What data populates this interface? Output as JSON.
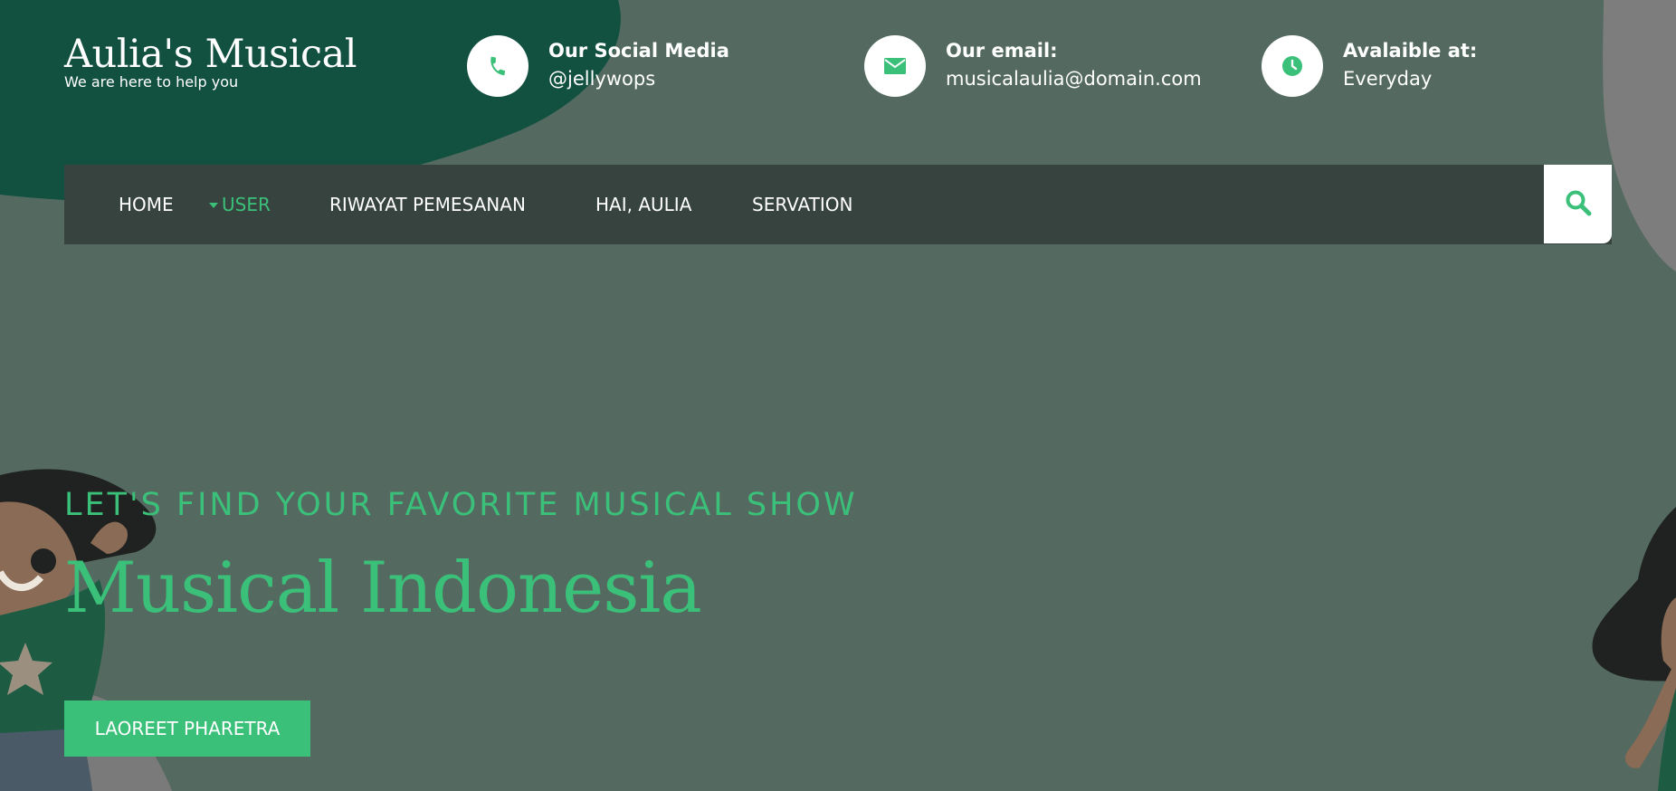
{
  "brand": {
    "title": "Aulia's Musical",
    "tagline": "We are here to help you"
  },
  "contact": [
    {
      "icon": "phone-icon",
      "label": "Our Social Media",
      "value": "@jellywops"
    },
    {
      "icon": "envelope-icon",
      "label": "Our email:",
      "value": "musicalaulia@domain.com"
    },
    {
      "icon": "clock-icon",
      "label": "Avalaible at:",
      "value": "Everyday"
    }
  ],
  "nav": {
    "items": [
      {
        "label": "HOME"
      },
      {
        "label": "USER",
        "active": true
      },
      {
        "label": "RIWAYAT PEMESANAN"
      },
      {
        "label": "HAI, AULIA"
      },
      {
        "label": "SERVATION"
      }
    ],
    "search_icon": "search-icon"
  },
  "hero": {
    "eyebrow": "LET'S FIND YOUR FAVORITE MUSICAL SHOW",
    "title": "Musical Indonesia",
    "cta_label": "LAOREET PHARETRA"
  },
  "colors": {
    "accent": "#3bc07a",
    "background": "#546a61",
    "dark_green": "#12503f",
    "nav_bar": "#37433e"
  }
}
